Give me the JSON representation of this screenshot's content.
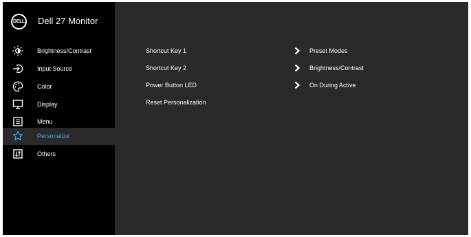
{
  "header": {
    "logo_text": "DELL",
    "title": "Dell 27 Monitor"
  },
  "sidebar": {
    "items": [
      {
        "label": "Brightness/Contrast",
        "icon": "brightness-icon"
      },
      {
        "label": "Input Source",
        "icon": "input-source-icon"
      },
      {
        "label": "Color",
        "icon": "color-palette-icon"
      },
      {
        "label": "Display",
        "icon": "display-icon"
      },
      {
        "label": "Menu",
        "icon": "menu-icon"
      },
      {
        "label": "Personalize",
        "icon": "star-icon",
        "selected": true
      },
      {
        "label": "Others",
        "icon": "others-icon"
      }
    ],
    "selected_color": "#3fa7e8"
  },
  "main": {
    "rows": [
      {
        "label": "Shortcut Key 1",
        "value": "Preset Modes",
        "has_chevron": true
      },
      {
        "label": "Shortcut Key 2",
        "value": "Brightness/Contrast",
        "has_chevron": true
      },
      {
        "label": "Power Button LED",
        "value": "On During Active",
        "has_chevron": true
      },
      {
        "label": "Reset Personalization"
      }
    ]
  }
}
